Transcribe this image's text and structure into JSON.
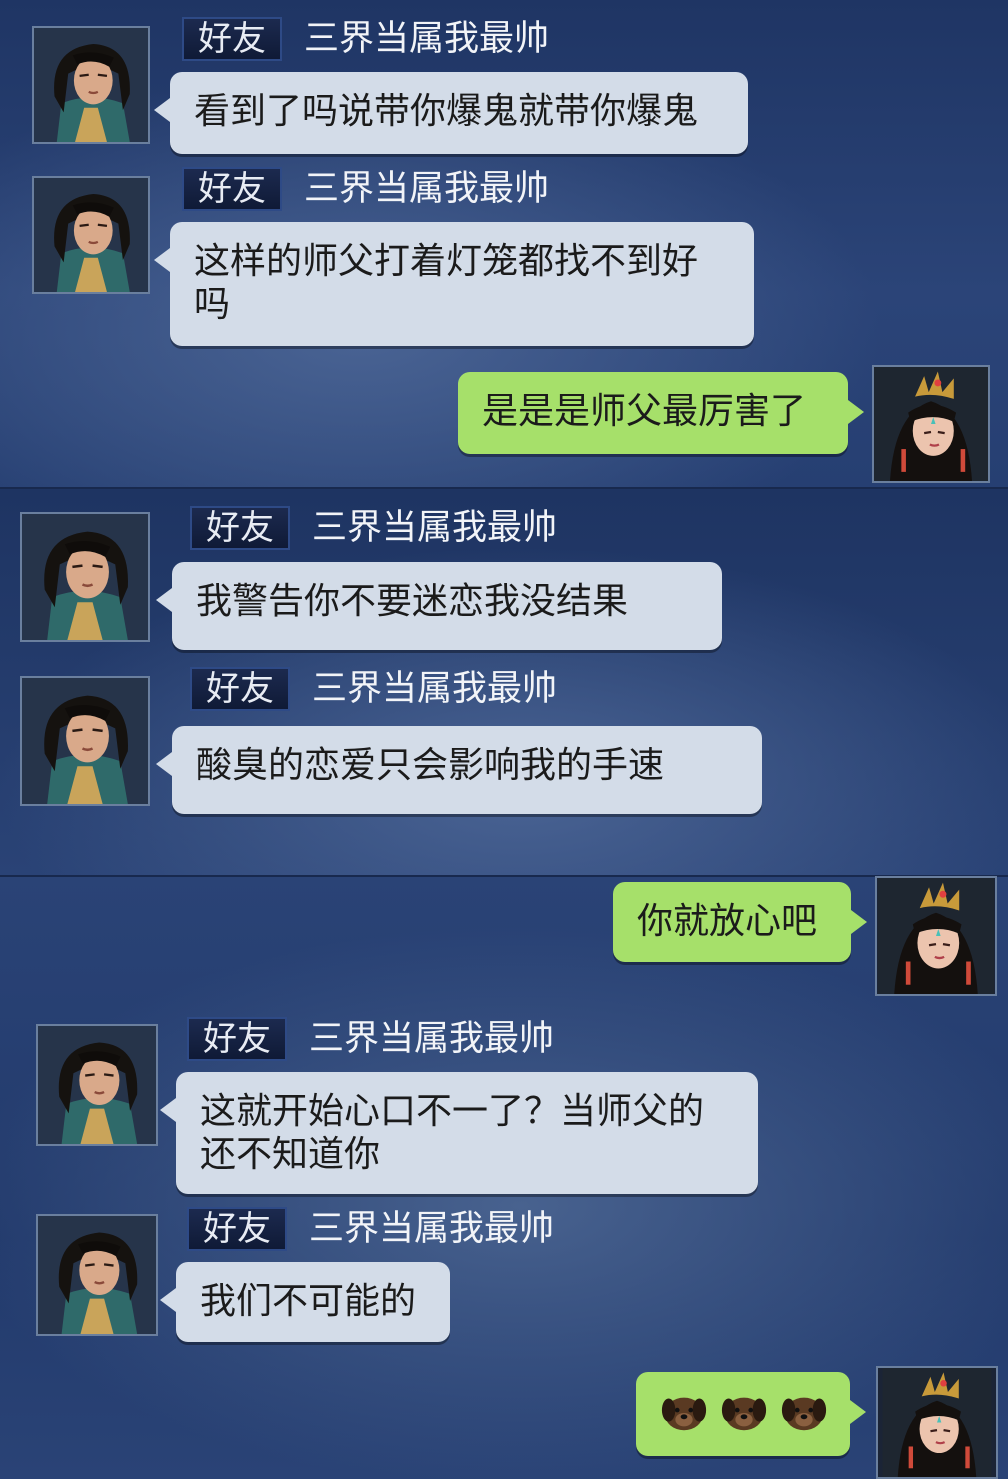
{
  "friend_tag": "好友",
  "friend_name": "三界当属我最帅",
  "messages": [
    {
      "text": "看到了吗说带你爆鬼就带你爆鬼"
    },
    {
      "text": "这样的师父打着灯笼都找不到好吗"
    },
    {
      "text": "是是是师父最厉害了"
    },
    {
      "text": "我警告你不要迷恋我没结果"
    },
    {
      "text": "酸臭的恋爱只会影响我的手速"
    },
    {
      "text": "你就放心吧"
    },
    {
      "text": "这就开始心口不一了？当师父的还不知道你"
    },
    {
      "text": "我们不可能的"
    },
    {
      "emojis": [
        "dog-face-emoji",
        "dog-face-emoji",
        "dog-face-emoji"
      ]
    }
  ],
  "colors": {
    "background": "#243a6a",
    "incoming_bubble": "#d3dce8",
    "outgoing_bubble": "#a6e06a",
    "tag_border": "#2e4a86"
  }
}
